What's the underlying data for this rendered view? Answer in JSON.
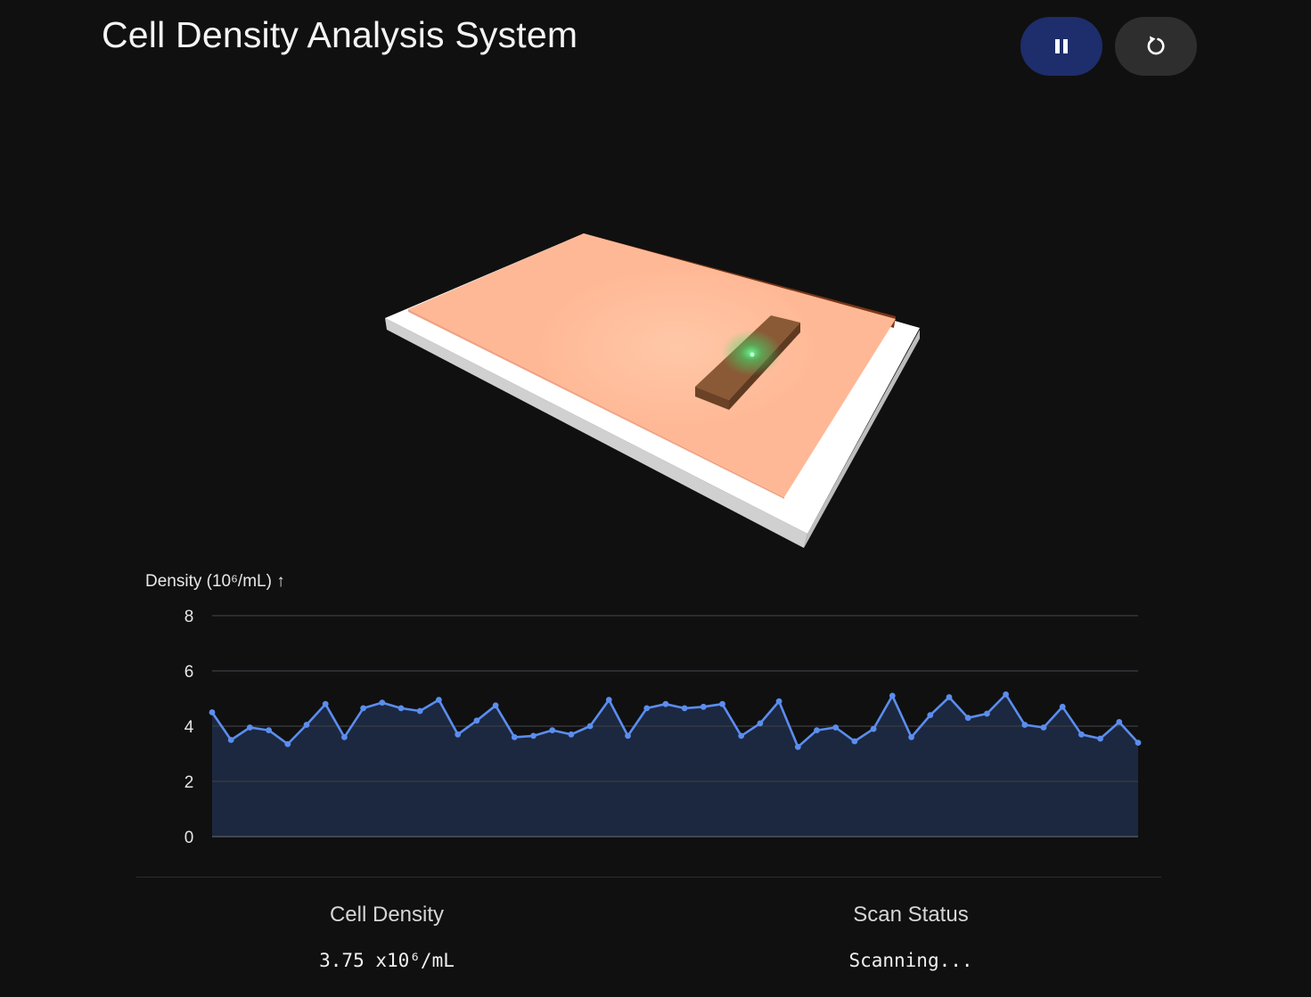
{
  "header": {
    "title": "Cell Density Analysis System"
  },
  "controls": {
    "pause_icon": "pause-icon",
    "reset_icon": "reset-icon",
    "pause_color": "#1e2d6b",
    "reset_color": "#2e2e2e"
  },
  "scene": {
    "tray_color": "#ffffff",
    "sample_color": "#ffb896",
    "scanner_color": "#8a5a36",
    "scanner_glow": "#3ddc6a"
  },
  "chart": {
    "axis_title": "Density (10⁶/mL) ↑"
  },
  "chart_data": {
    "type": "area",
    "title": "",
    "ylabel": "Density (10⁶/mL)",
    "xlabel": "",
    "ylim": [
      0,
      8
    ],
    "yticks": [
      "0",
      "2",
      "4",
      "6",
      "8"
    ],
    "grid": true,
    "line_color": "#5b8def",
    "fill_color": "#1e2a42",
    "series": [
      {
        "values": [
          4.5,
          3.5,
          3.95,
          3.85,
          3.35,
          4.05,
          4.8,
          3.6,
          4.65,
          4.85,
          4.65,
          4.55,
          4.95,
          3.7,
          4.2,
          4.75,
          3.6,
          3.65,
          3.85,
          3.7,
          4.0,
          4.95,
          3.65,
          4.65,
          4.8,
          4.65,
          4.7,
          4.8,
          3.65,
          4.1,
          4.9,
          3.25,
          3.85,
          3.95,
          3.45,
          3.9,
          5.1,
          3.6,
          4.4,
          5.05,
          4.3,
          4.45,
          5.15,
          4.05,
          3.95,
          4.7,
          3.7,
          3.55,
          4.15,
          3.4
        ]
      }
    ]
  },
  "stats": {
    "density_label": "Cell Density",
    "density_value": "3.75 x10⁶/mL",
    "status_label": "Scan Status",
    "status_value": "Scanning..."
  }
}
